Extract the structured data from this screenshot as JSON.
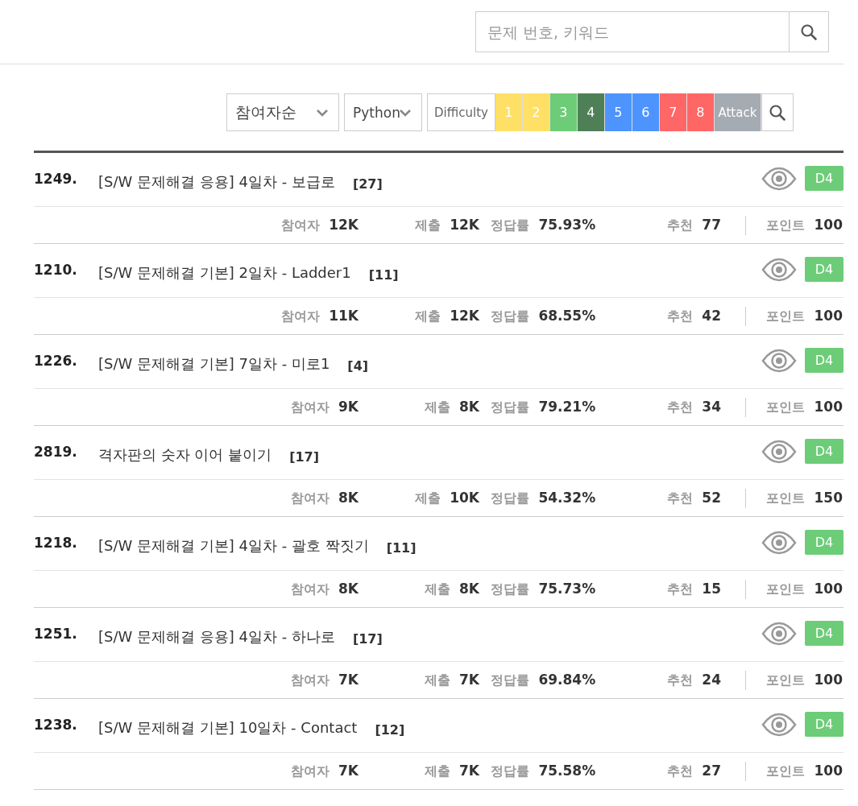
{
  "search": {
    "placeholder": "문제 번호, 키워드"
  },
  "filters": {
    "sort": "참여자순",
    "language": "Python",
    "difficulty_label": "Difficulty",
    "levels": [
      {
        "label": "1",
        "color": "#ffe066",
        "selected": false
      },
      {
        "label": "2",
        "color": "#ffe066",
        "selected": false
      },
      {
        "label": "3",
        "color": "#6dcc78",
        "selected": false
      },
      {
        "label": "4",
        "color": "#4f7f57",
        "selected": false
      },
      {
        "label": "5",
        "color": "#4d94ff",
        "selected": false
      },
      {
        "label": "6",
        "color": "#4d94ff",
        "selected": false
      },
      {
        "label": "7",
        "color": "#ff6666",
        "selected": false
      },
      {
        "label": "8",
        "color": "#ff6666",
        "selected": false
      },
      {
        "label": "Attack",
        "color": "#a5abb3",
        "selected": false
      }
    ]
  },
  "problems": [
    {
      "number": "1249.",
      "title": "[S/W 문제해결 응용] 4일차 - 보급로",
      "count": "[27]",
      "badge": "D4",
      "stats": [
        {
          "label": "참여자",
          "value": "12K"
        },
        {
          "label": "제출",
          "value": "12K"
        },
        {
          "label": "정답률",
          "value": "75.93%"
        },
        {
          "label": "추천",
          "value": "77"
        },
        {
          "label": "포인트",
          "value": "100"
        }
      ]
    },
    {
      "number": "1210.",
      "title": "[S/W 문제해결 기본] 2일차 - Ladder1",
      "count": "[11]",
      "badge": "D4",
      "stats": [
        {
          "label": "참여자",
          "value": "11K"
        },
        {
          "label": "제출",
          "value": "12K"
        },
        {
          "label": "정답률",
          "value": "68.55%"
        },
        {
          "label": "추천",
          "value": "42"
        },
        {
          "label": "포인트",
          "value": "100"
        }
      ]
    },
    {
      "number": "1226.",
      "title": "[S/W 문제해결 기본] 7일차 - 미로1",
      "count": "[4]",
      "badge": "D4",
      "stats": [
        {
          "label": "참여자",
          "value": "9K"
        },
        {
          "label": "제출",
          "value": "8K"
        },
        {
          "label": "정답률",
          "value": "79.21%"
        },
        {
          "label": "추천",
          "value": "34"
        },
        {
          "label": "포인트",
          "value": "100"
        }
      ]
    },
    {
      "number": "2819.",
      "title": "격자판의 숫자 이어 붙이기",
      "count": "[17]",
      "badge": "D4",
      "stats": [
        {
          "label": "참여자",
          "value": "8K"
        },
        {
          "label": "제출",
          "value": "10K"
        },
        {
          "label": "정답률",
          "value": "54.32%"
        },
        {
          "label": "추천",
          "value": "52"
        },
        {
          "label": "포인트",
          "value": "150"
        }
      ]
    },
    {
      "number": "1218.",
      "title": "[S/W 문제해결 기본] 4일차 - 괄호 짝짓기",
      "count": "[11]",
      "badge": "D4",
      "stats": [
        {
          "label": "참여자",
          "value": "8K"
        },
        {
          "label": "제출",
          "value": "8K"
        },
        {
          "label": "정답률",
          "value": "75.73%"
        },
        {
          "label": "추천",
          "value": "15"
        },
        {
          "label": "포인트",
          "value": "100"
        }
      ]
    },
    {
      "number": "1251.",
      "title": "[S/W 문제해결 응용] 4일차 - 하나로",
      "count": "[17]",
      "badge": "D4",
      "stats": [
        {
          "label": "참여자",
          "value": "7K"
        },
        {
          "label": "제출",
          "value": "7K"
        },
        {
          "label": "정답률",
          "value": "69.84%"
        },
        {
          "label": "추천",
          "value": "24"
        },
        {
          "label": "포인트",
          "value": "100"
        }
      ]
    },
    {
      "number": "1238.",
      "title": "[S/W 문제해결 기본] 10일차 - Contact",
      "count": "[12]",
      "badge": "D4",
      "stats": [
        {
          "label": "참여자",
          "value": "7K"
        },
        {
          "label": "제출",
          "value": "7K"
        },
        {
          "label": "정답률",
          "value": "75.58%"
        },
        {
          "label": "추천",
          "value": "27"
        },
        {
          "label": "포인트",
          "value": "100"
        }
      ]
    }
  ]
}
